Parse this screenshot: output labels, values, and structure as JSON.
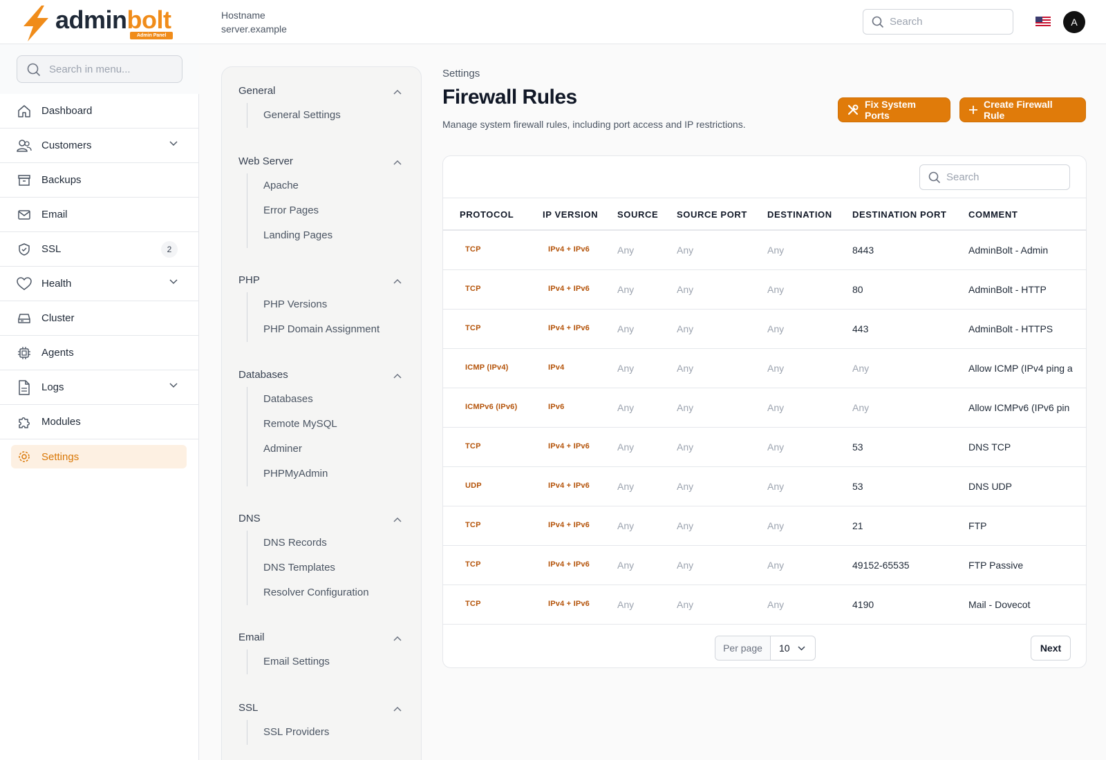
{
  "header": {
    "logo_dark": "admin",
    "logo_accent": "bolt",
    "logo_badge": "Admin Panel",
    "hostname_label": "Hostname",
    "hostname_value": "server.example",
    "search_placeholder": "Search",
    "avatar_initial": "A",
    "flag_icon": "us-flag-icon"
  },
  "sidebar": {
    "search_placeholder": "Search in menu...",
    "items": [
      {
        "label": "Dashboard",
        "icon": "home-icon"
      },
      {
        "label": "Customers",
        "icon": "users-icon",
        "expandable": true
      },
      {
        "label": "Backups",
        "icon": "archive-icon"
      },
      {
        "label": "Email",
        "icon": "mail-icon"
      },
      {
        "label": "SSL",
        "icon": "shield-check-icon",
        "badge": "2"
      },
      {
        "label": "Health",
        "icon": "heart-icon",
        "expandable": true
      },
      {
        "label": "Cluster",
        "icon": "server-icon"
      },
      {
        "label": "Agents",
        "icon": "cpu-icon"
      },
      {
        "label": "Logs",
        "icon": "document-icon",
        "expandable": true
      },
      {
        "label": "Modules",
        "icon": "puzzle-icon"
      },
      {
        "label": "Settings",
        "icon": "gear-icon",
        "active": true
      }
    ]
  },
  "settings_menu": [
    {
      "title": "General",
      "items": [
        "General Settings"
      ]
    },
    {
      "title": "Web Server",
      "items": [
        "Apache",
        "Error Pages",
        "Landing Pages"
      ]
    },
    {
      "title": "PHP",
      "items": [
        "PHP Versions",
        "PHP Domain Assignment"
      ]
    },
    {
      "title": "Databases",
      "items": [
        "Databases",
        "Remote MySQL",
        "Adminer",
        "PHPMyAdmin"
      ]
    },
    {
      "title": "DNS",
      "items": [
        "DNS Records",
        "DNS Templates",
        "Resolver Configuration"
      ]
    },
    {
      "title": "Email",
      "items": [
        "Email Settings"
      ]
    },
    {
      "title": "SSL",
      "items": [
        "SSL Providers"
      ]
    }
  ],
  "main": {
    "breadcrumb": "Settings",
    "title": "Firewall Rules",
    "description": "Manage system firewall rules, including port access and IP restrictions.",
    "fix_button": "Fix System Ports",
    "create_button": "Create Firewall Rule",
    "table_search_placeholder": "Search",
    "columns": [
      "PROTOCOL",
      "IP VERSION",
      "SOURCE",
      "SOURCE PORT",
      "DESTINATION",
      "DESTINATION PORT",
      "COMMENT"
    ],
    "rows": [
      {
        "protocol": "TCP",
        "ip_version": "IPv4 + IPv6",
        "source": "Any",
        "source_port": "Any",
        "destination": "Any",
        "destination_port": "8443",
        "comment": "AdminBolt - Admin"
      },
      {
        "protocol": "TCP",
        "ip_version": "IPv4 + IPv6",
        "source": "Any",
        "source_port": "Any",
        "destination": "Any",
        "destination_port": "80",
        "comment": "AdminBolt - HTTP"
      },
      {
        "protocol": "TCP",
        "ip_version": "IPv4 + IPv6",
        "source": "Any",
        "source_port": "Any",
        "destination": "Any",
        "destination_port": "443",
        "comment": "AdminBolt - HTTPS"
      },
      {
        "protocol": "ICMP (IPv4)",
        "ip_version": "IPv4",
        "source": "Any",
        "source_port": "Any",
        "destination": "Any",
        "destination_port": "Any",
        "comment": "Allow ICMP (IPv4 ping a"
      },
      {
        "protocol": "ICMPv6 (IPv6)",
        "ip_version": "IPv6",
        "source": "Any",
        "source_port": "Any",
        "destination": "Any",
        "destination_port": "Any",
        "comment": "Allow ICMPv6 (IPv6 pin"
      },
      {
        "protocol": "TCP",
        "ip_version": "IPv4 + IPv6",
        "source": "Any",
        "source_port": "Any",
        "destination": "Any",
        "destination_port": "53",
        "comment": "DNS TCP"
      },
      {
        "protocol": "UDP",
        "ip_version": "IPv4 + IPv6",
        "source": "Any",
        "source_port": "Any",
        "destination": "Any",
        "destination_port": "53",
        "comment": "DNS UDP"
      },
      {
        "protocol": "TCP",
        "ip_version": "IPv4 + IPv6",
        "source": "Any",
        "source_port": "Any",
        "destination": "Any",
        "destination_port": "21",
        "comment": "FTP"
      },
      {
        "protocol": "TCP",
        "ip_version": "IPv4 + IPv6",
        "source": "Any",
        "source_port": "Any",
        "destination": "Any",
        "destination_port": "49152-65535",
        "comment": "FTP Passive"
      },
      {
        "protocol": "TCP",
        "ip_version": "IPv4 + IPv6",
        "source": "Any",
        "source_port": "Any",
        "destination": "Any",
        "destination_port": "4190",
        "comment": "Mail - Dovecot"
      }
    ],
    "per_page_label": "Per page",
    "per_page_value": "10",
    "next_button": "Next"
  },
  "colors": {
    "accent": "#e07b0a",
    "accent_text": "#b45309",
    "active_bg": "#fdf0e2"
  }
}
